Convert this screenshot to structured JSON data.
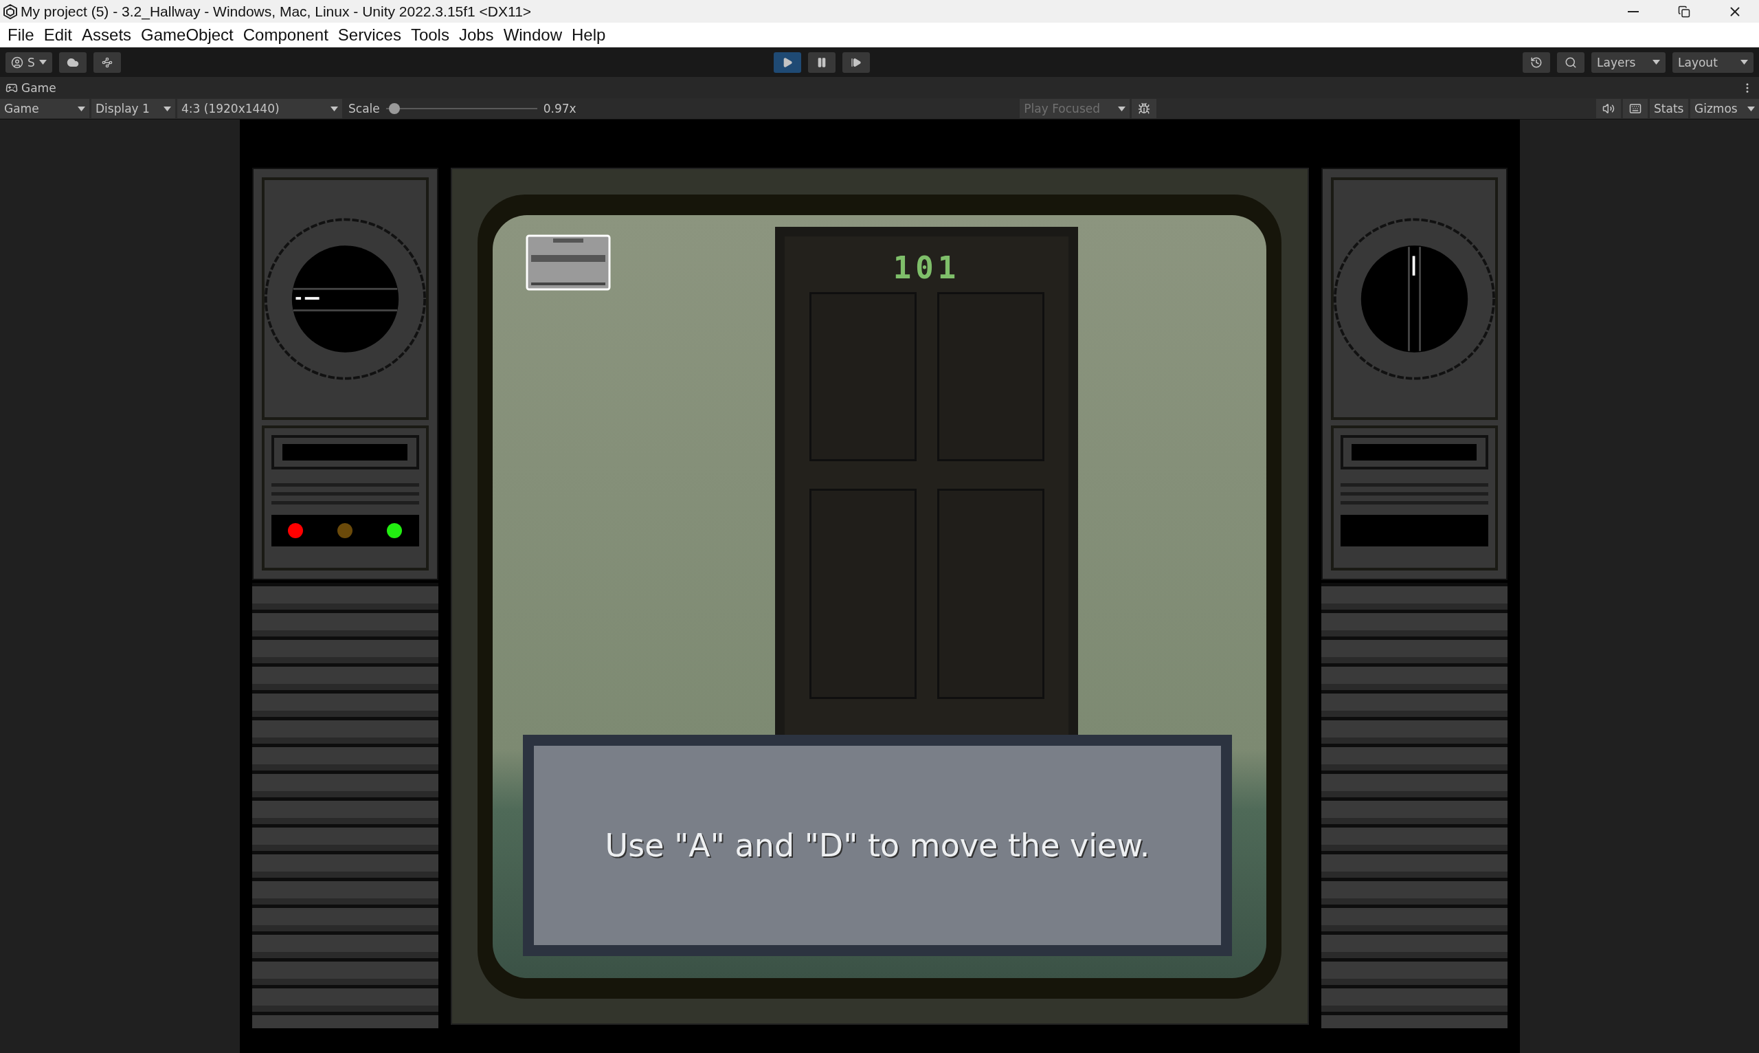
{
  "window": {
    "title": "My project (5) - 3.2_Hallway - Windows, Mac, Linux - Unity 2022.3.15f1 <DX11>"
  },
  "menu": [
    "File",
    "Edit",
    "Assets",
    "GameObject",
    "Component",
    "Services",
    "Tools",
    "Jobs",
    "Window",
    "Help"
  ],
  "toolbar": {
    "account": "S",
    "play_controls": [
      {
        "kind": "play",
        "on": true
      },
      {
        "kind": "pause",
        "on": false
      },
      {
        "kind": "step",
        "on": false
      }
    ],
    "layers": "Layers",
    "layout": "Layout"
  },
  "game_tab": {
    "label": "Game"
  },
  "game_toolbar": {
    "view": "Game",
    "display": "Display 1",
    "aspect": "4:3 (1920x1440)",
    "scale_label": "Scale",
    "scale": {
      "level": 0.02
    },
    "scale_reading": "0.97x",
    "play_focused": {
      "label": "Play Focused",
      "disabled": true
    },
    "stats": "Stats",
    "gizmos": "Gizmos"
  },
  "game": {
    "door_number": "101",
    "dialogue": "Use \"A\" and \"D\" to move the view.",
    "left_lights": [
      {
        "color": "#ff0000"
      },
      {
        "color": "#6b4a0a"
      },
      {
        "color": "#22ee11"
      }
    ]
  }
}
